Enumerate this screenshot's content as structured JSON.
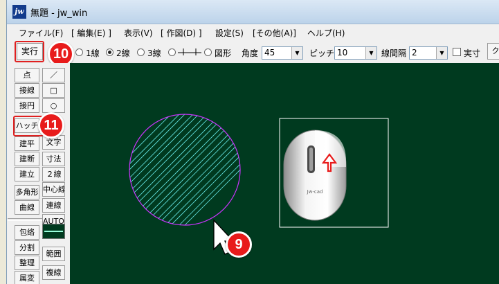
{
  "window": {
    "title": "無題 - jw_win",
    "logo": "jw"
  },
  "menu": [
    "ファイル(F)",
    "[ 編集(E) ]",
    "表示(V)",
    "[ 作図(D) ]",
    "設定(S)",
    "[その他(A)]",
    "ヘルプ(H)"
  ],
  "toolbar": {
    "exec_label": "実行",
    "options": {
      "line1": "1線",
      "line2": "2線",
      "line3": "3線",
      "figure": "図形"
    },
    "angle_label": "角度",
    "angle_value": "45",
    "pitch_label": "ピッチ",
    "pitch_value": "10",
    "spacing_label": "線間隔",
    "spacing_value": "2",
    "actual_size_label": "実寸",
    "more_label": "ク"
  },
  "tools": {
    "left": [
      "点",
      "接線",
      "接円",
      "ハッチ",
      "建平",
      "建断",
      "建立",
      "多角形",
      "曲線",
      "包络",
      "分割",
      "整理",
      "属変"
    ],
    "right": [
      "／",
      "□",
      "○",
      "文字",
      "寸法",
      "２線",
      "中心線",
      "連線",
      "AUTO",
      "範囲",
      "複線"
    ]
  },
  "badges": {
    "exec": "10",
    "hatch": "11",
    "pointer": "9"
  },
  "mouse_label": "Jw-cad",
  "colors": {
    "canvas": "#003a1f",
    "highlight": "#e81b1b",
    "circle": "#cc33ff",
    "hatch": "#66e6e6"
  }
}
